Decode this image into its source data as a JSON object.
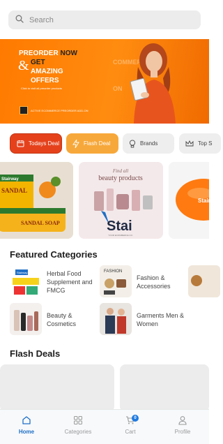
{
  "search": {
    "placeholder": "Search"
  },
  "banner": {
    "line1_a": "PREORDER",
    "line1_b": "NOW",
    "line2_a": "GET",
    "line2_b": "AMAZING",
    "line2_c": "OFFERS",
    "small_text": "Click to visit all preorder products",
    "presale_text": "ACTIVE ECOMMERCE PREORDER ADD-ON",
    "ghost_text_1": "COMMERCE",
    "ghost_text_2": "ON",
    "accent_color": "#ff7a00"
  },
  "tabs": [
    {
      "label": "Todays Deal",
      "icon": "calendar-icon"
    },
    {
      "label": "Flash Deal",
      "icon": "flash-icon"
    },
    {
      "label": "Brands",
      "icon": "bulb-icon"
    },
    {
      "label": "Top S",
      "icon": "crown-icon"
    }
  ],
  "carousel": {
    "card1": {
      "brand": "Stairway",
      "product": "SANDAL",
      "product_sub": "SANDAL SOAP"
    },
    "card2": {
      "title_small": "Find all",
      "title_big": "beauty products",
      "brand": "Stai",
      "tagline": "YOUR ECOMMERCE CO."
    },
    "card3": {
      "brand": "Stair"
    }
  },
  "featured": {
    "title": "Featured Categories",
    "items": [
      {
        "label": "Herbal Food Supplement and FMCG",
        "thumb": "herbal-food-thumb",
        "thumb_text": "Stairway"
      },
      {
        "label": "Fashion & Accessories",
        "thumb": "fashion-thumb",
        "thumb_text": "FASHION"
      },
      {
        "label": "Beauty & Cosmetics",
        "thumb": "beauty-thumb"
      },
      {
        "label": "Garments Men & Women",
        "thumb": "garments-thumb"
      }
    ]
  },
  "flash_deals": {
    "title": "Flash Deals"
  },
  "nav": {
    "home": "Home",
    "categories": "Categories",
    "cart": "Cart",
    "cart_count": "0",
    "profile": "Profile",
    "active_color": "#1f6fc5"
  }
}
